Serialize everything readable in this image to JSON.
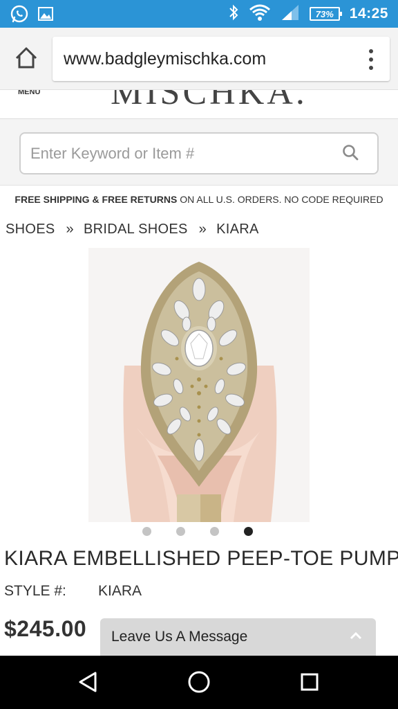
{
  "status_bar": {
    "time": "14:25",
    "battery_level": "73%",
    "left_icons": [
      "whatsapp-icon",
      "gallery-icon"
    ],
    "right_icons": [
      "bluetooth-icon",
      "wifi-icon",
      "signal-icon",
      "battery-icon"
    ]
  },
  "browser": {
    "url": "www.badgleymischka.com",
    "home_icon": "home-icon",
    "menu_icon": "overflow-menu-icon"
  },
  "site_header": {
    "menu_label": "MENU",
    "logo_partial": "MISCHKA."
  },
  "search": {
    "placeholder": "Enter Keyword or Item #",
    "value": ""
  },
  "promo": {
    "bold": "FREE SHIPPING & FREE RETURNS",
    "rest": " ON ALL U.S. ORDERS. NO CODE REQUIRED"
  },
  "breadcrumb": {
    "items": [
      "SHOES",
      "BRIDAL SHOES",
      "KIARA"
    ],
    "separator": "»"
  },
  "carousel": {
    "total": 4,
    "active_index": 4
  },
  "product": {
    "title": "KIARA EMBELLISHED PEEP-TOE PUMP",
    "style_label": "STYLE #:",
    "style_value": "KIARA",
    "price": "$245.00"
  },
  "chat": {
    "label": "Leave Us A Message"
  },
  "colors": {
    "status_bar": "#2b94d6",
    "nav_bar": "#000000",
    "shoe": "#efcfc0"
  }
}
